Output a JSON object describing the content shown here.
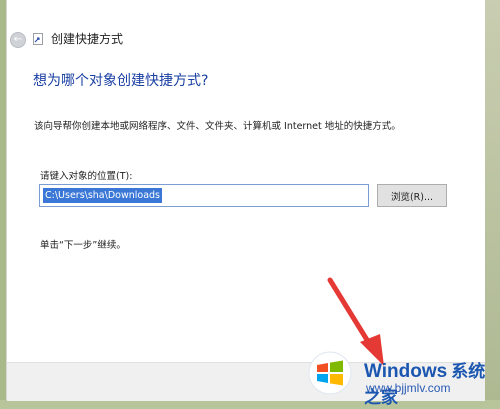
{
  "window": {
    "title": "创建快捷方式"
  },
  "main": {
    "heading": "想为哪个对象创建快捷方式?",
    "description": "该向导帮你创建本地或网络程序、文件、文件夹、计算机或 Internet 地址的快捷方式。",
    "location_label": "请键入对象的位置(T):",
    "location_value": "C:\\Users\\sha\\Downloads",
    "browse_label": "浏览(R)...",
    "hint": "单击“下一步”继续。"
  },
  "watermark": {
    "brand": "Windows",
    "brand_cn": "系统之家",
    "url": "www.bjjmlv.com"
  },
  "colors": {
    "heading": "#1a3fa3",
    "selection": "#3a77d6",
    "arrow": "#e53935"
  },
  "icons": [
    "back-arrow-icon",
    "shortcut-icon",
    "windows-logo-icon"
  ]
}
